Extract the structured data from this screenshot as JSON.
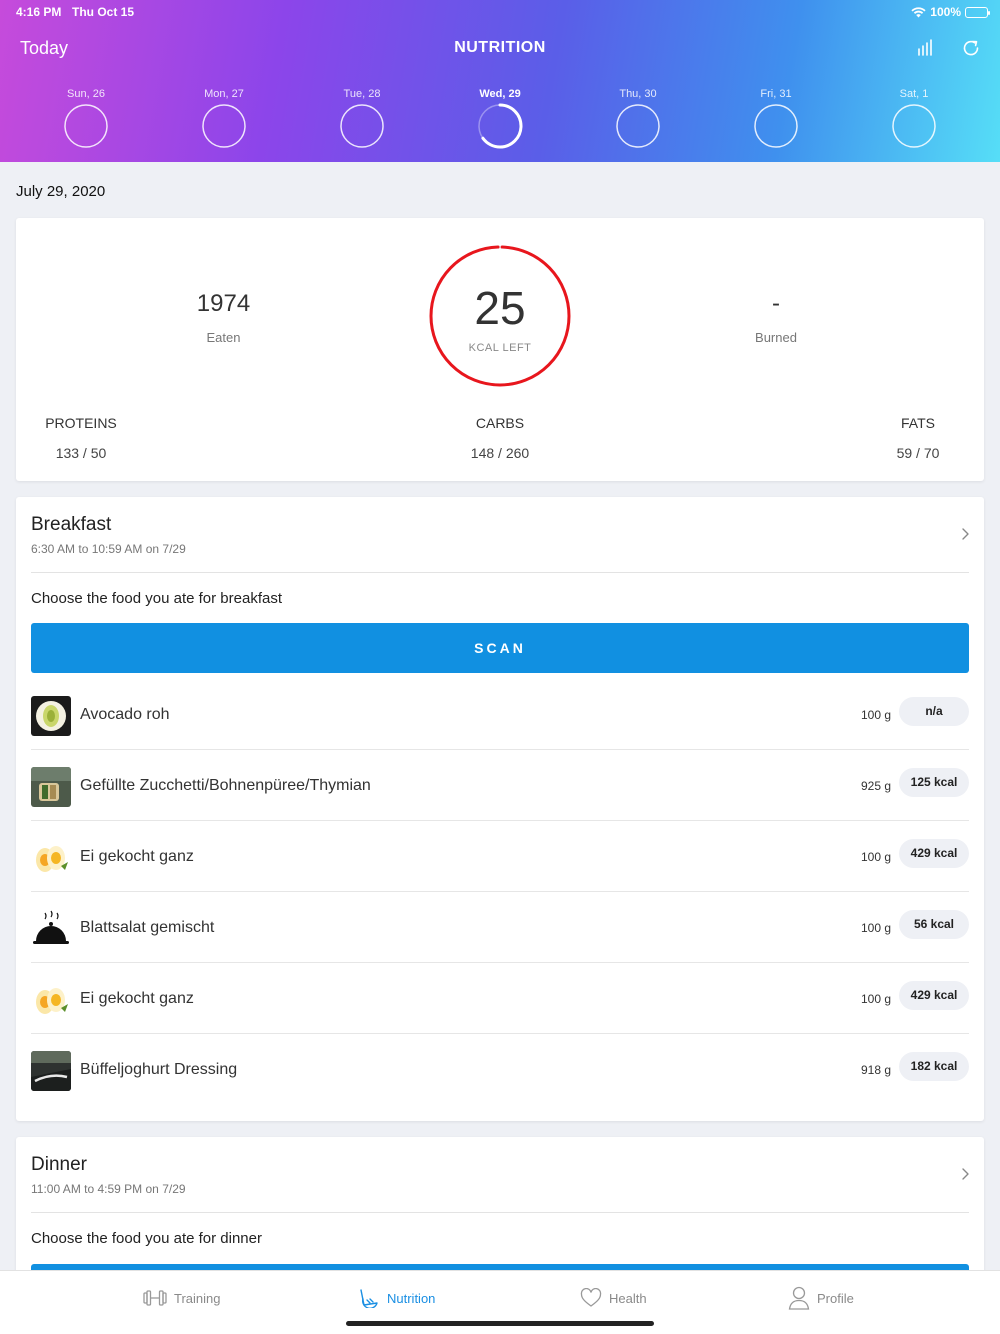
{
  "status_bar": {
    "time": "4:16 PM",
    "date": "Thu Oct 15",
    "battery": "100%"
  },
  "header": {
    "today_label": "Today",
    "title": "NUTRITION",
    "icons": [
      "stats-icon",
      "refresh-icon"
    ]
  },
  "week": [
    {
      "label": "Sun, 26",
      "progress": 0
    },
    {
      "label": "Mon, 27",
      "progress": 0
    },
    {
      "label": "Tue, 28",
      "progress": 0
    },
    {
      "label": "Wed, 29",
      "progress": 0.65,
      "selected": true
    },
    {
      "label": "Thu, 30",
      "progress": 0
    },
    {
      "label": "Fri, 31",
      "progress": 0
    },
    {
      "label": "Sat, 1",
      "progress": 0
    }
  ],
  "date_heading": "July 29, 2020",
  "summary": {
    "eaten_value": "1974",
    "eaten_label": "Eaten",
    "kcal_left": "25",
    "kcal_left_label": "KCAL LEFT",
    "kcal_ring_progress": 0.99,
    "ring_color": "#e8161d",
    "burned_value": "-",
    "burned_label": "Burned",
    "macros": [
      {
        "label": "PROTEINS",
        "value": "133 / 50"
      },
      {
        "label": "CARBS",
        "value": "148 / 260"
      },
      {
        "label": "FATS",
        "value": "59 / 70"
      }
    ]
  },
  "breakfast": {
    "title": "Breakfast",
    "time_range": "6:30 AM to 10:59 AM on 7/29",
    "prompt": "Choose the food you ate for breakfast",
    "scan_label": "SCAN",
    "items": [
      {
        "name": "Avocado roh",
        "amount": "100 g",
        "kcal": "n/a",
        "icon": "avocado-icon"
      },
      {
        "name": "Gefüllte Zucchetti/Bohnenpüree/Thymian",
        "amount": "925 g",
        "kcal": "125 kcal",
        "icon": "zucchini-dish-icon"
      },
      {
        "name": "Ei gekocht ganz",
        "amount": "100 g",
        "kcal": "429 kcal",
        "icon": "egg-icon"
      },
      {
        "name": "Blattsalat gemischt",
        "amount": "100 g",
        "kcal": "56 kcal",
        "icon": "cloche-icon"
      },
      {
        "name": "Ei gekocht ganz",
        "amount": "100 g",
        "kcal": "429 kcal",
        "icon": "egg-icon"
      },
      {
        "name": "Büffeljoghurt Dressing",
        "amount": "918 g",
        "kcal": "182 kcal",
        "icon": "dressing-icon"
      }
    ]
  },
  "dinner": {
    "title": "Dinner",
    "time_range": "11:00 AM to 4:59 PM on 7/29",
    "prompt": "Choose the food you ate for dinner"
  },
  "tabs": [
    {
      "label": "Training",
      "icon": "dumbbell-icon"
    },
    {
      "label": "Nutrition",
      "icon": "nutrition-icon",
      "active": true
    },
    {
      "label": "Health",
      "icon": "heart-icon"
    },
    {
      "label": "Profile",
      "icon": "profile-icon"
    }
  ],
  "colors": {
    "accent": "#1190e1",
    "ring": "#e8161d",
    "tab_active": "#1a8fe3"
  }
}
